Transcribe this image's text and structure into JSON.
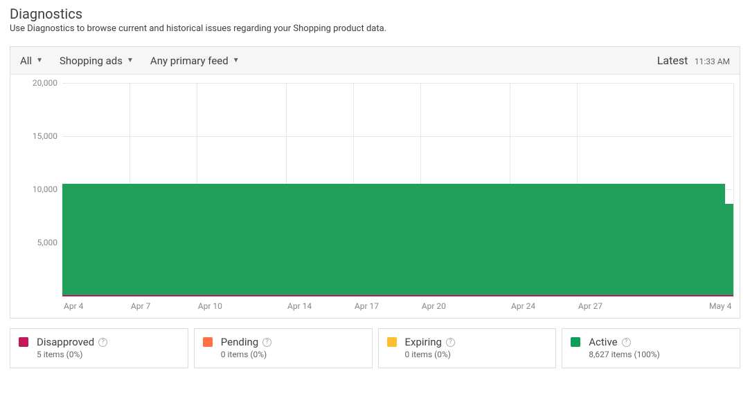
{
  "header": {
    "title": "Diagnostics",
    "subtitle": "Use Diagnostics to browse current and historical issues regarding your Shopping product data."
  },
  "filters": {
    "all": "All",
    "destinations": "Shopping ads",
    "feeds": "Any primary feed",
    "latest_label": "Latest",
    "latest_time": "11:33 AM"
  },
  "legend": [
    {
      "name": "Disapproved",
      "items": "5 items (0%)",
      "color": "#c2185b"
    },
    {
      "name": "Pending",
      "items": "0 items (0%)",
      "color": "#ff7043"
    },
    {
      "name": "Expiring",
      "items": "0 items (0%)",
      "color": "#fbc02d"
    },
    {
      "name": "Active",
      "items": "8,627 items (100%)",
      "color": "#0f9d58"
    }
  ],
  "chart_data": {
    "type": "area",
    "xlabel": "",
    "ylabel": "",
    "ylim": [
      0,
      20000
    ],
    "y_ticks": [
      5000,
      10000,
      15000,
      20000
    ],
    "y_tick_labels": [
      "5,000",
      "10,000",
      "15,000",
      "20,000"
    ],
    "x_categories": [
      "Apr 4",
      "Apr 7",
      "Apr 10",
      "Apr 14",
      "Apr 17",
      "Apr 20",
      "Apr 24",
      "Apr 27",
      "May 4"
    ],
    "series": [
      {
        "name": "Active",
        "values": [
          10500,
          10500,
          10500,
          10500,
          10500,
          10500,
          10500,
          10500,
          8627
        ]
      },
      {
        "name": "Disapproved",
        "values": [
          5,
          5,
          5,
          5,
          5,
          5,
          5,
          5,
          5
        ]
      },
      {
        "name": "Pending",
        "values": [
          0,
          0,
          0,
          0,
          0,
          0,
          0,
          0,
          0
        ]
      },
      {
        "name": "Expiring",
        "values": [
          0,
          0,
          0,
          0,
          0,
          0,
          0,
          0,
          0
        ]
      }
    ]
  }
}
